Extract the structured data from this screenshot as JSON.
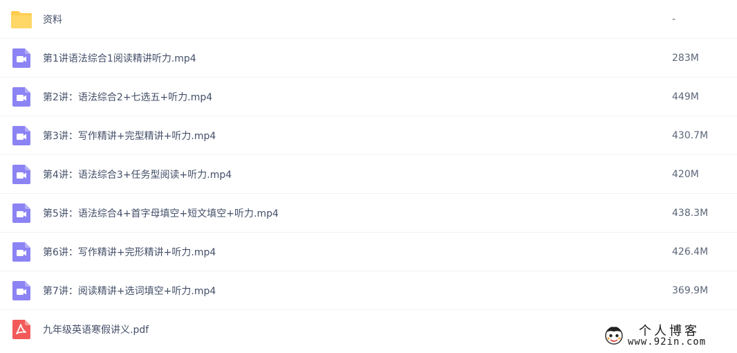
{
  "files": [
    {
      "name": "资料",
      "size": "-",
      "icon": "folder-icon"
    },
    {
      "name": "第1讲语法综合1阅读精讲听力.mp4",
      "size": "283M",
      "icon": "video-file-icon"
    },
    {
      "name": "第2讲：语法综合2+七选五+听力.mp4",
      "size": "449M",
      "icon": "video-file-icon"
    },
    {
      "name": "第3讲：写作精讲+完型精讲+听力.mp4",
      "size": "430.7M",
      "icon": "video-file-icon"
    },
    {
      "name": "第4讲：语法综合3+任务型阅读+听力.mp4",
      "size": "420M",
      "icon": "video-file-icon"
    },
    {
      "name": "第5讲：语法综合4+首字母填空+短文填空+听力.mp4",
      "size": "438.3M",
      "icon": "video-file-icon"
    },
    {
      "name": "第6讲：写作精讲+完形精讲+听力.mp4",
      "size": "426.4M",
      "icon": "video-file-icon"
    },
    {
      "name": "第7讲：阅读精讲+选词填空+听力.mp4",
      "size": "369.9M",
      "icon": "video-file-icon"
    },
    {
      "name": "九年级英语寒假讲义.pdf",
      "size": "",
      "icon": "pdf-file-icon"
    }
  ],
  "watermark": {
    "title": "个人博客",
    "url": "www.92in.com"
  },
  "colors": {
    "folder": "#ffcc4d",
    "video": "#8c83f4",
    "pdf": "#f25a5a"
  }
}
